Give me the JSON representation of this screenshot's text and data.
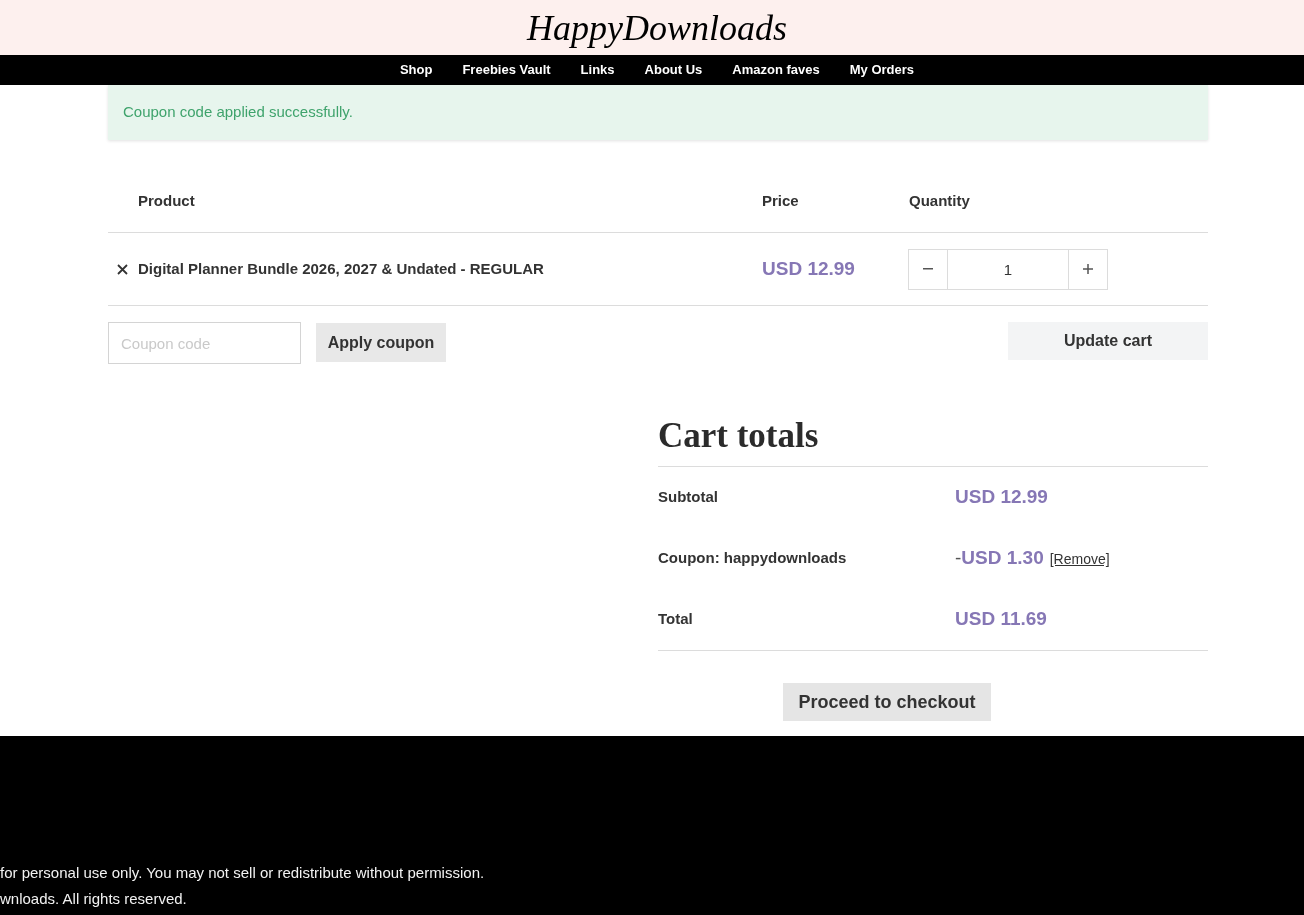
{
  "header": {
    "logo": "HappyDownloads"
  },
  "nav": {
    "items": [
      "Shop",
      "Freebies Vault",
      "Links",
      "About Us",
      "Amazon faves",
      "My Orders"
    ]
  },
  "notice": {
    "message": "Coupon code applied successfully."
  },
  "cart_table": {
    "columns": [
      "Product",
      "Price",
      "Quantity"
    ],
    "rows": [
      {
        "product": "Digital Planner Bundle 2026, 2027 & Undated - REGULAR",
        "price": "USD 12.99",
        "quantity": "1"
      }
    ]
  },
  "coupon_form": {
    "placeholder": "Coupon code",
    "apply_button": "Apply coupon"
  },
  "update_button": "Update cart",
  "cart_totals": {
    "title": "Cart totals",
    "rows": [
      {
        "kind": "amount",
        "label": "Subtotal",
        "value": "USD 12.99"
      },
      {
        "kind": "discount",
        "label": "Coupon: happydownloads",
        "value_prefix": "-",
        "value": "USD 1.30",
        "remove_link": "[Remove]"
      },
      {
        "kind": "amount",
        "label": "Total",
        "value": "USD 11.69"
      }
    ],
    "checkout_button": "Proceed to checkout"
  },
  "footer": {
    "lines": [
      "for personal use only. You may not sell or redistribute without permission.",
      "wnloads. All rights reserved."
    ]
  }
}
